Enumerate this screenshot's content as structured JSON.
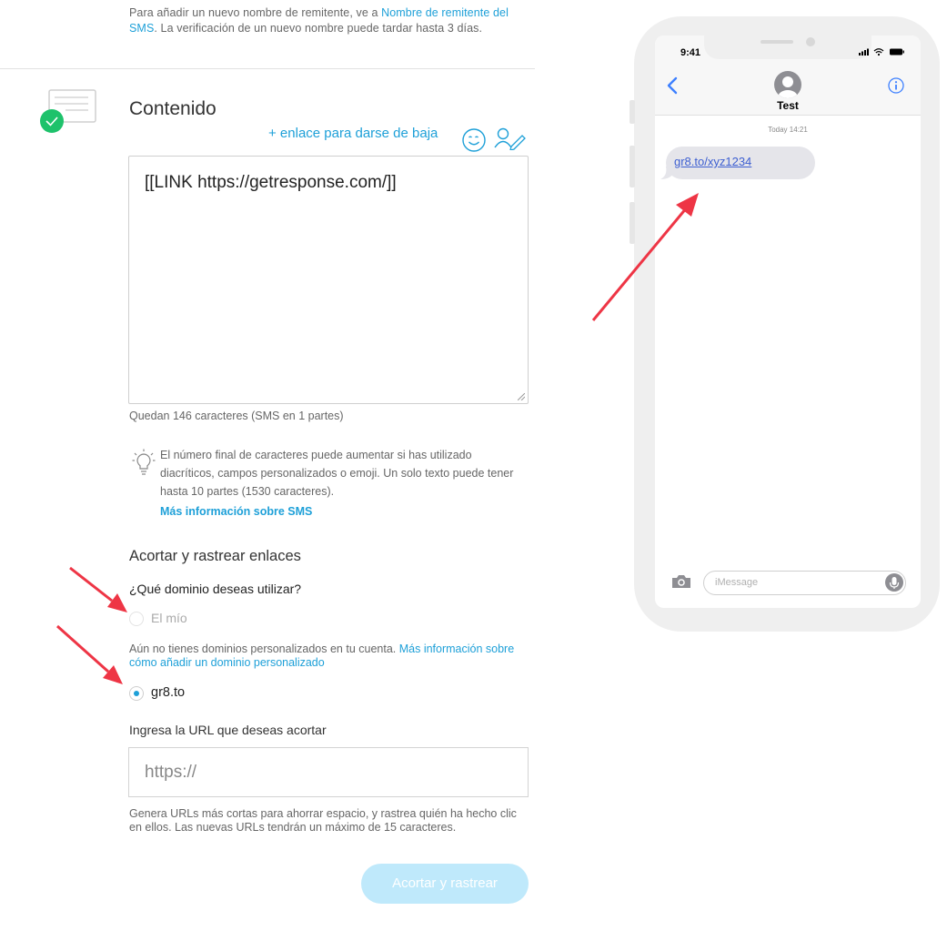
{
  "sender_note": {
    "text_before": "Para añadir un nuevo nombre de remitente, ve a ",
    "link": "Nombre de remitente del SMS",
    "text_after": ". La verificación de un nuevo nombre puede tardar hasta 3 días."
  },
  "content": {
    "title": "Contenido",
    "unsubscribe_link": "+ enlace para darse de baja",
    "message_text": "[[LINK https://getresponse.com/]]",
    "char_count": "Quedan 146 caracteres (SMS en 1 partes)",
    "tip_text": "El número final de caracteres puede aumentar si has utilizado diacríticos, campos personalizados o emoji. Un solo texto puede tener hasta 10 partes (1530 caracteres).",
    "tip_link": "Más información sobre SMS"
  },
  "shorten": {
    "title": "Acortar y rastrear enlaces",
    "question": "¿Qué dominio deseas utilizar?",
    "option_mine": "El mío",
    "no_domains_text": "Aún no tienes dominios personalizados en tu cuenta. ",
    "no_domains_link": "Más información sobre cómo añadir un dominio personalizado",
    "option_gr8": "gr8.to",
    "selected_option": "gr8.to",
    "url_label": "Ingresa la URL que deseas acortar",
    "url_placeholder": "https://",
    "help_text": "Genera URLs más cortas para ahorrar espacio, y rastrea quién ha hecho clic en ellos. Las nuevas URLs tendrán un máximo de 15 caracteres.",
    "button_label": "Acortar y rastrear"
  },
  "phone": {
    "status_time": "9:41",
    "contact_name": "Test",
    "message_time": "Today 14:21",
    "message_link": "gr8.to/xyz1234",
    "input_placeholder": "iMessage"
  },
  "colors": {
    "accent": "#1ea0d8",
    "check_green": "#1ec26b",
    "button_disabled": "#bfe9fb",
    "arrow_red": "#ee3545",
    "ios_blue": "#3d80ff"
  }
}
